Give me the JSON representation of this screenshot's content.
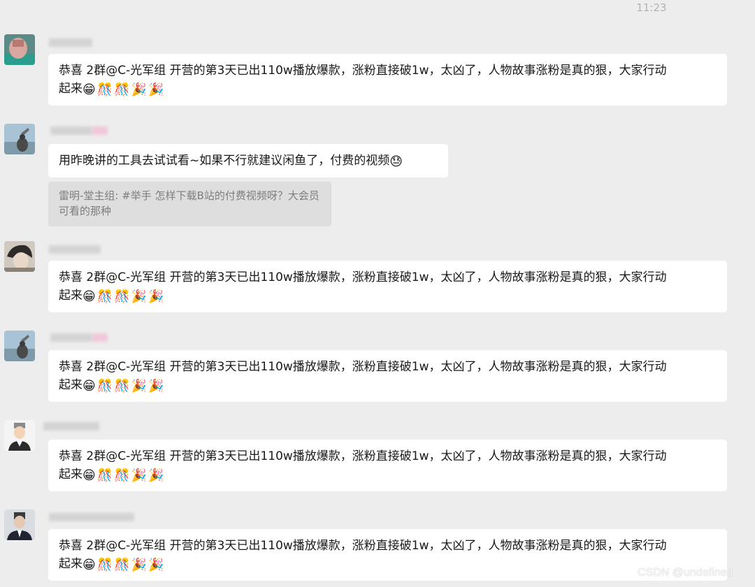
{
  "timestamp": "11:23",
  "congrats_text": "恭喜 2群@C-光军组 开营的第3天已出110w播放爆款，涨粉直接破1w，太凶了，人物故事涨粉是真的狠，大家行动\n起来",
  "congrats_emojis": [
    "😁",
    "🎊",
    "🎊",
    "🎉",
    "🎉"
  ],
  "reply": {
    "text": "用昨晚讲的工具去试试看~如果不行就建议闲鱼了，付费的视频",
    "emoji": "😓"
  },
  "quote": {
    "text": "雷明-堂主组: #举手 怎样下载B站的付费视频呀？大会员可看的那种"
  },
  "watermark": "CSDN @undefined",
  "colors": {
    "background": "#ededed",
    "bubble": "#ffffff",
    "quote_bg": "#dedede",
    "timestamp": "#b2b2b2"
  }
}
